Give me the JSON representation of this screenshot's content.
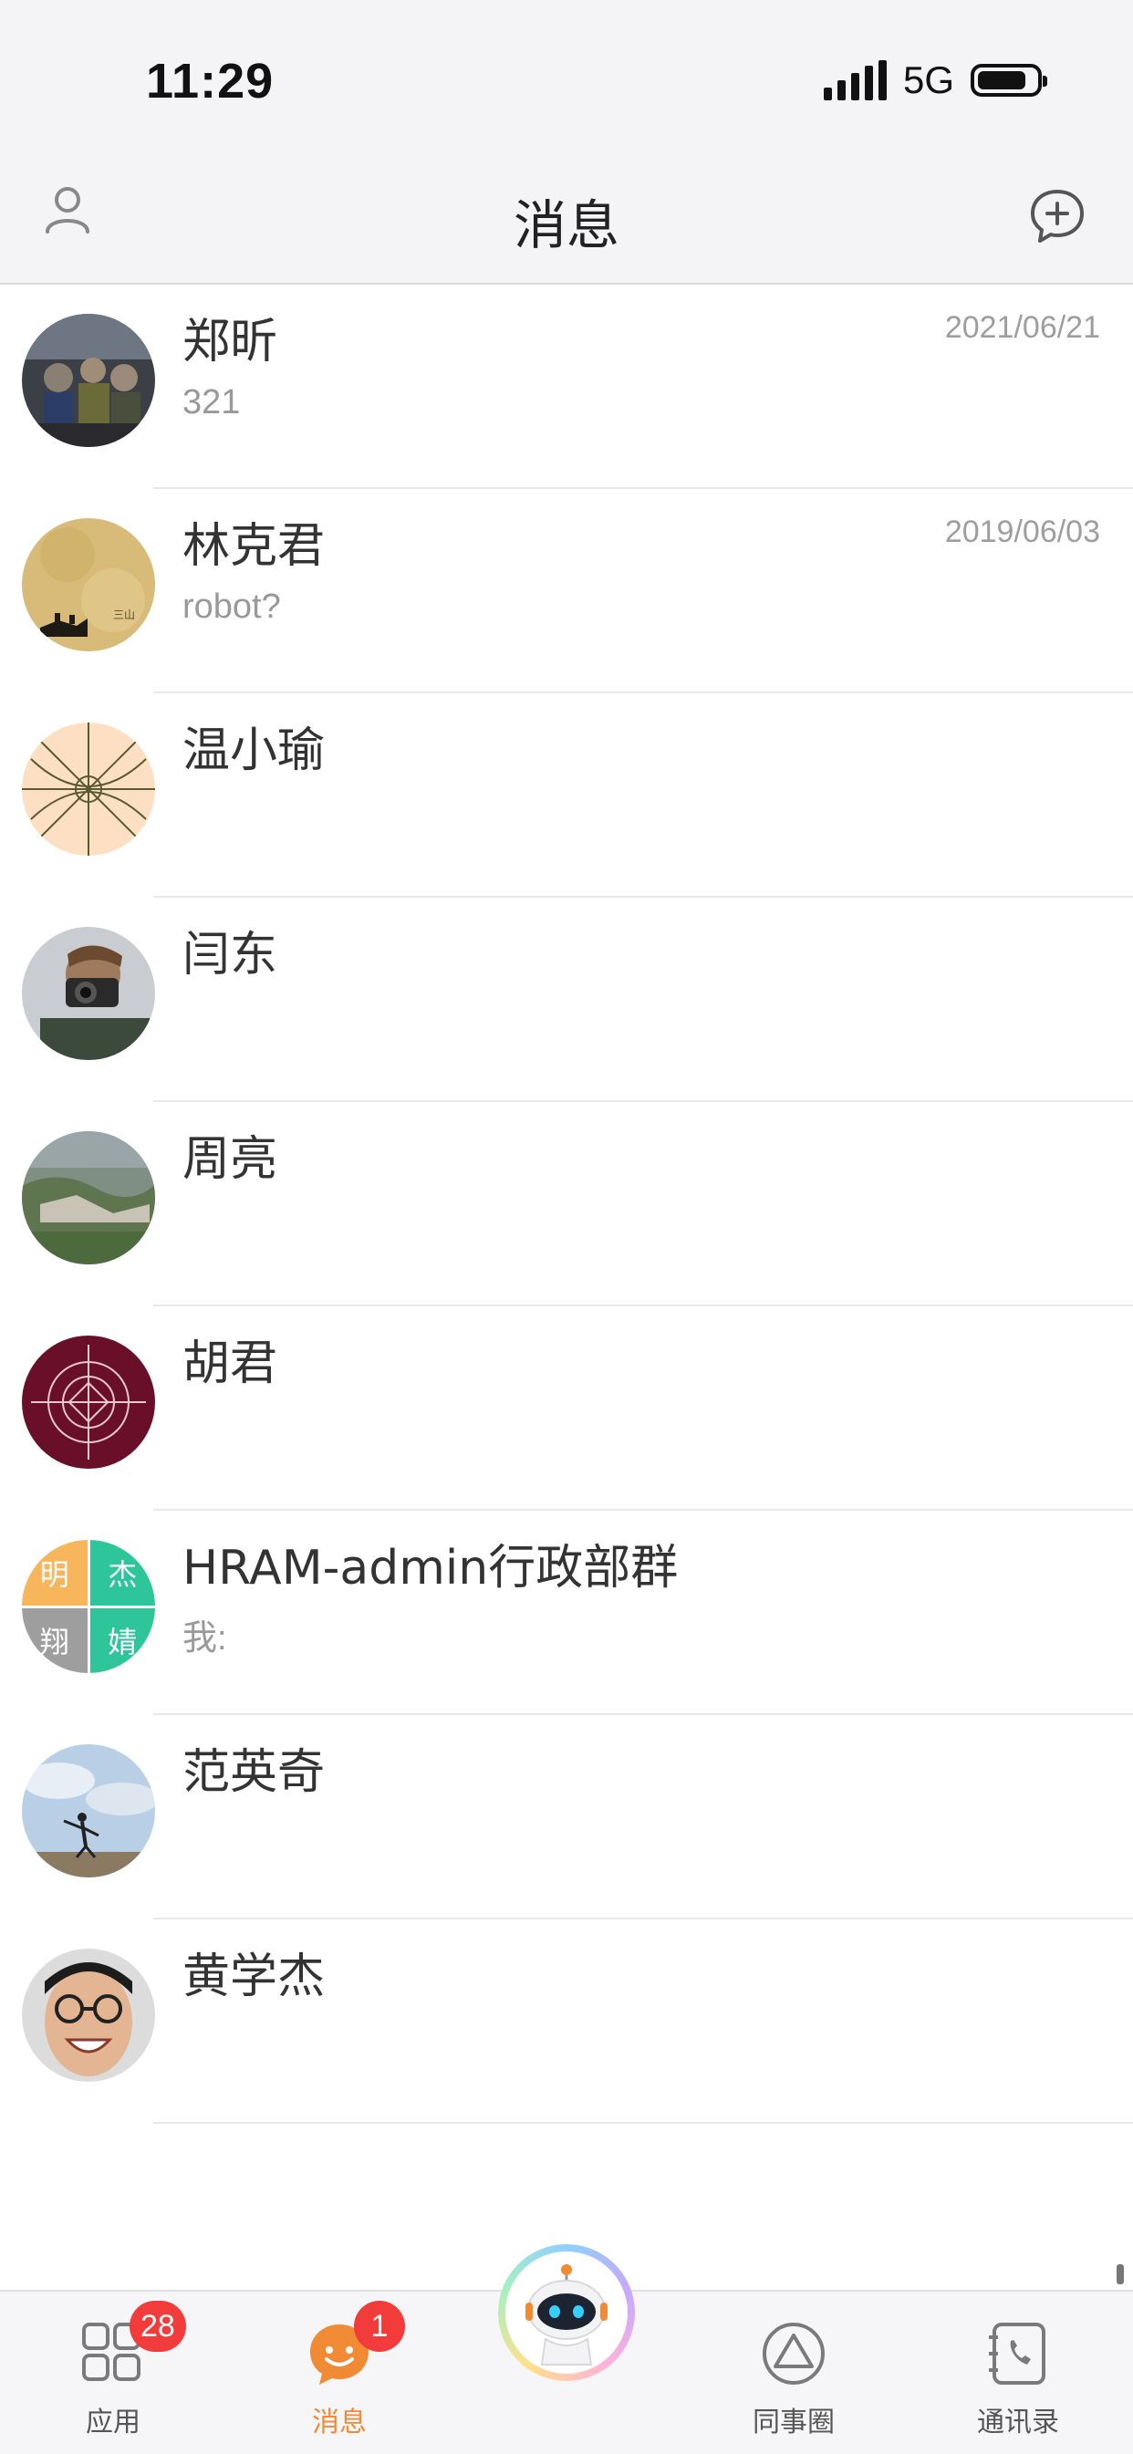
{
  "status_bar": {
    "time": "11:29",
    "network": "5G"
  },
  "header": {
    "title": "消息"
  },
  "conversations": [
    {
      "name": "郑昕",
      "preview": "321",
      "date": "2021/06/21",
      "avatar": "photo-group"
    },
    {
      "name": "林克君",
      "preview": "robot?",
      "date": "2019/06/03",
      "avatar": "photo-parchment-map"
    },
    {
      "name": "温小瑜",
      "preview": "",
      "date": "",
      "avatar": "pattern-peach"
    },
    {
      "name": "闫东",
      "preview": "",
      "date": "",
      "avatar": "photo-camera-man"
    },
    {
      "name": "周亮",
      "preview": "",
      "date": "",
      "avatar": "photo-landscape"
    },
    {
      "name": "胡君",
      "preview": "",
      "date": "",
      "avatar": "pattern-maroon"
    },
    {
      "name": "HRAM-admin行政部群",
      "preview": "我:",
      "date": "",
      "avatar": "group-quad",
      "group_tiles": [
        {
          "char": "明",
          "color": "#f7b55c"
        },
        {
          "char": "杰",
          "color": "#2fc59a"
        },
        {
          "char": "翔",
          "color": "#9e9e9e"
        },
        {
          "char": "婧",
          "color": "#2fc59a"
        }
      ]
    },
    {
      "name": "范英奇",
      "preview": "",
      "date": "",
      "avatar": "photo-beach-pose"
    },
    {
      "name": "黄学杰",
      "preview": "",
      "date": "",
      "avatar": "photo-face"
    }
  ],
  "tabbar": {
    "tabs": [
      {
        "label": "应用",
        "badge": "28",
        "active": false,
        "icon": "apps-grid-icon"
      },
      {
        "label": "消息",
        "badge": "1",
        "active": true,
        "icon": "smile-chat-icon"
      },
      {
        "label": "同事圈",
        "badge": "",
        "active": false,
        "icon": "triangle-circle-icon"
      },
      {
        "label": "通讯录",
        "badge": "",
        "active": false,
        "icon": "phone-book-icon"
      }
    ],
    "center": "robot-assistant-icon"
  },
  "colors": {
    "accent": "#f08a34",
    "badge": "#f23b3b"
  }
}
